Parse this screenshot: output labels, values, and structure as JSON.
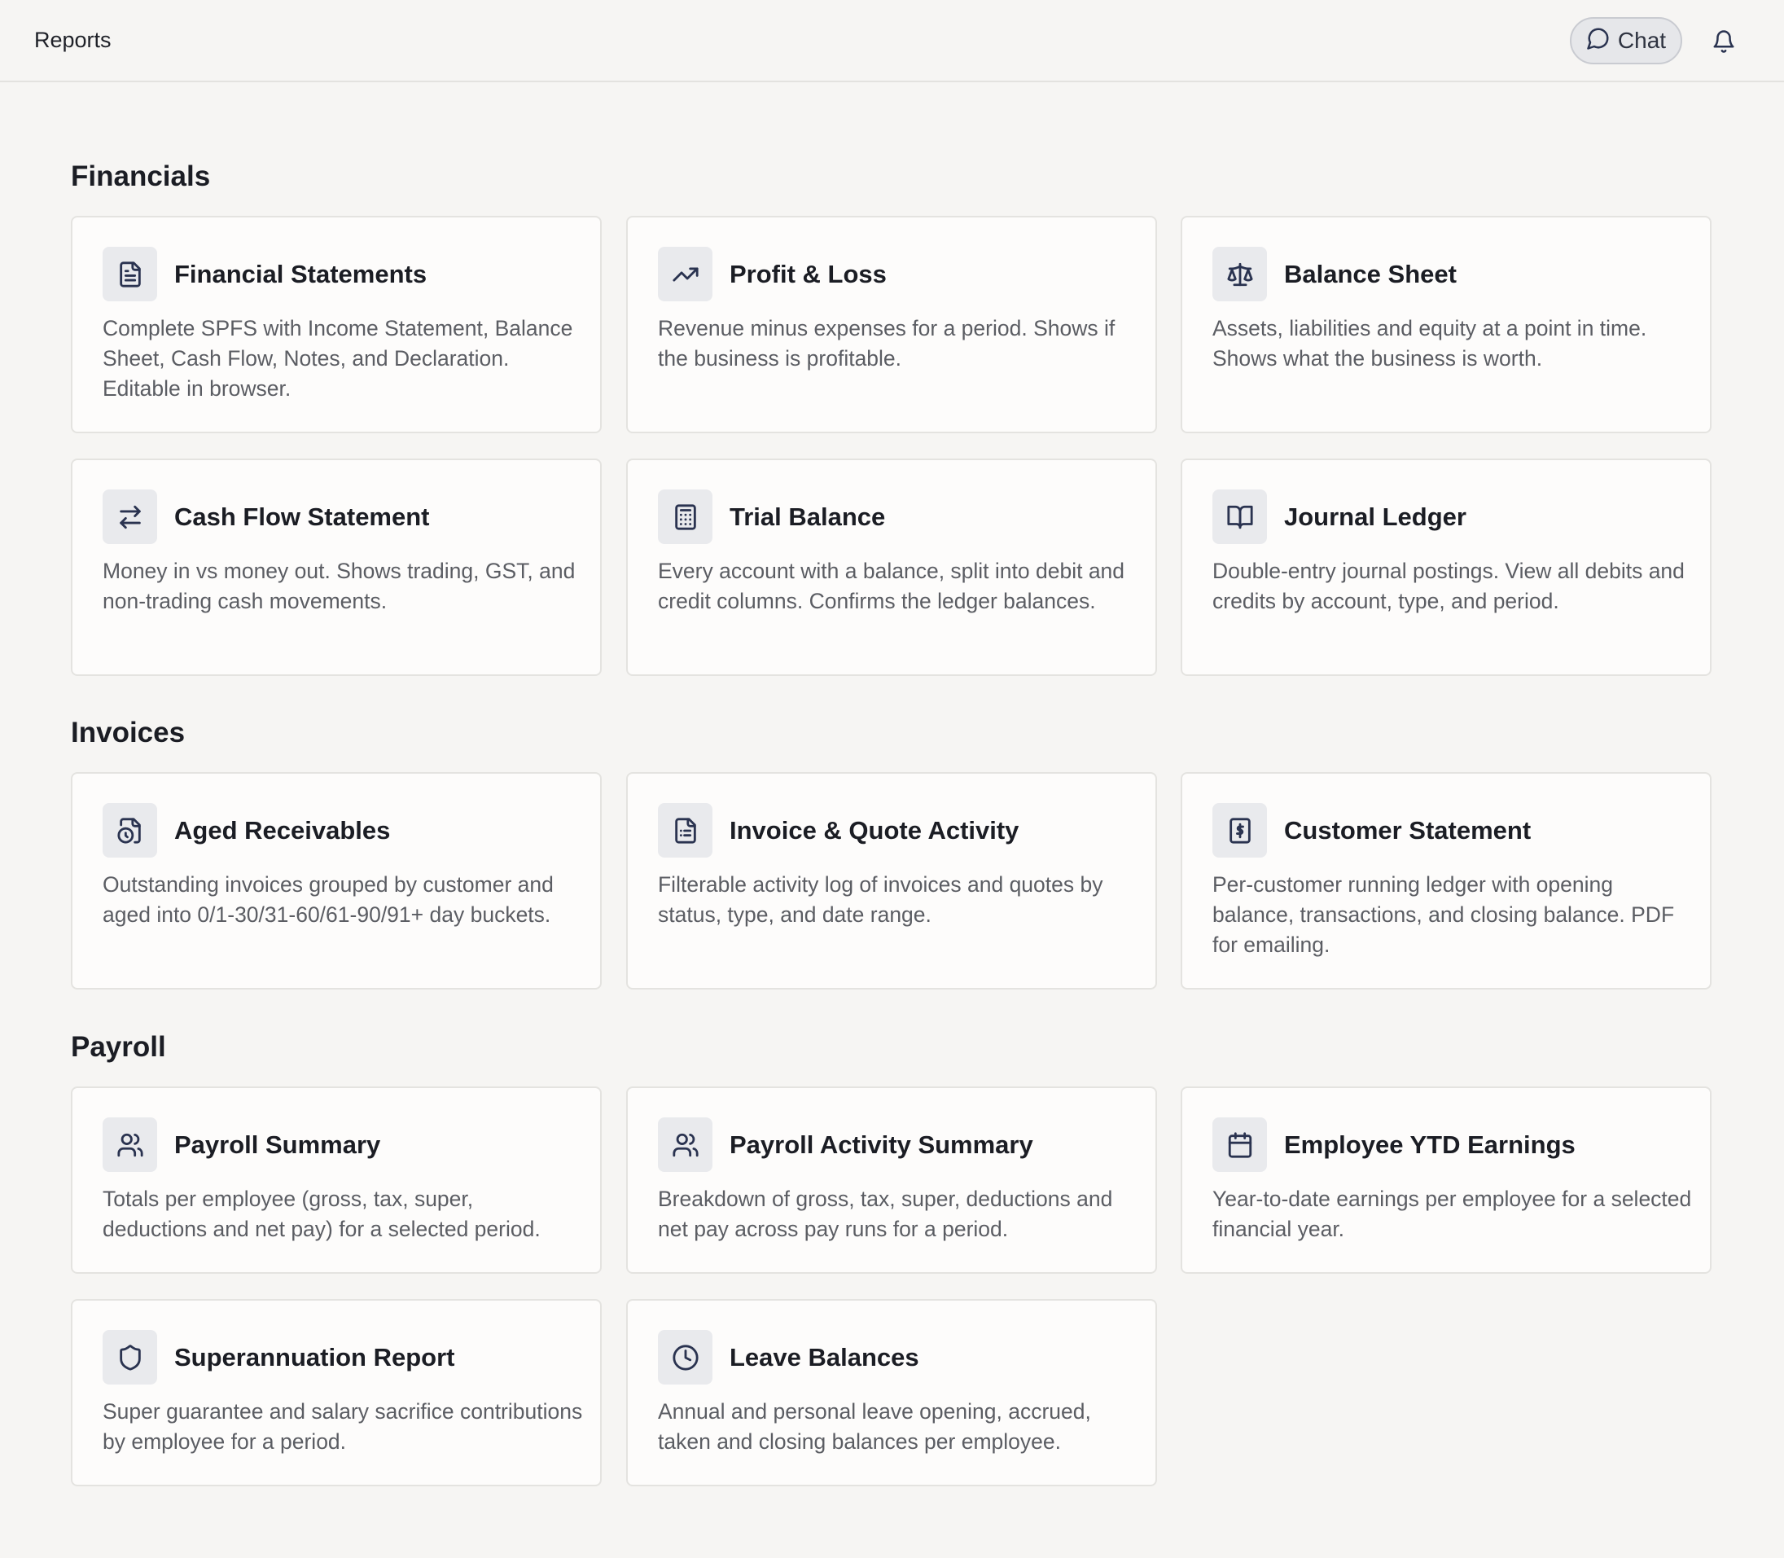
{
  "header": {
    "title": "Reports",
    "chat_label": "Chat"
  },
  "sections": {
    "financials": {
      "title": "Financials",
      "cards": [
        {
          "title": "Financial Statements",
          "description": "Complete SPFS with Income Statement, Balance Sheet, Cash Flow, Notes, and Declaration. Editable in browser.",
          "icon": "document-icon"
        },
        {
          "title": "Profit & Loss",
          "description": "Revenue minus expenses for a period. Shows if the business is profitable.",
          "icon": "trending-up-icon"
        },
        {
          "title": "Balance Sheet",
          "description": "Assets, liabilities and equity at a point in time. Shows what the business is worth.",
          "icon": "scale-icon"
        },
        {
          "title": "Cash Flow Statement",
          "description": "Money in vs money out. Shows trading, GST, and non-trading cash movements.",
          "icon": "arrows-exchange-icon"
        },
        {
          "title": "Trial Balance",
          "description": "Every account with a balance, split into debit and credit columns. Confirms the ledger balances.",
          "icon": "calculator-icon"
        },
        {
          "title": "Journal Ledger",
          "description": "Double-entry journal postings. View all debits and credits by account, type, and period.",
          "icon": "open-book-icon"
        }
      ]
    },
    "invoices": {
      "title": "Invoices",
      "cards": [
        {
          "title": "Aged Receivables",
          "description": "Outstanding invoices grouped by customer and aged into 0/1-30/31-60/61-90/91+ day buckets.",
          "icon": "file-clock-icon"
        },
        {
          "title": "Invoice & Quote Activity",
          "description": "Filterable activity log of invoices and quotes by status, type, and date range.",
          "icon": "file-list-icon"
        },
        {
          "title": "Customer Statement",
          "description": "Per-customer running ledger with opening balance, transactions, and closing balance. PDF for emailing.",
          "icon": "receipt-dollar-icon"
        }
      ]
    },
    "payroll": {
      "title": "Payroll",
      "cards": [
        {
          "title": "Payroll Summary",
          "description": "Totals per employee (gross, tax, super, deductions and net pay) for a selected period.",
          "icon": "users-icon"
        },
        {
          "title": "Payroll Activity Summary",
          "description": "Breakdown of gross, tax, super, deductions and net pay across pay runs for a period.",
          "icon": "users-icon"
        },
        {
          "title": "Employee YTD Earnings",
          "description": "Year-to-date earnings per employee for a selected financial year.",
          "icon": "calendar-icon"
        },
        {
          "title": "Superannuation Report",
          "description": "Super guarantee and salary sacrifice contributions by employee for a period.",
          "icon": "shield-icon"
        },
        {
          "title": "Leave Balances",
          "description": "Annual and personal leave opening, accrued, taken and closing balances per employee.",
          "icon": "clock-icon"
        }
      ]
    }
  },
  "colors": {
    "background": "#f6f5f3",
    "card_background": "#fdfcfb",
    "icon_tile": "#e9eaed",
    "icon_stroke": "#2a3350",
    "text_primary": "#1b1d24",
    "text_secondary": "#5b5d63"
  }
}
